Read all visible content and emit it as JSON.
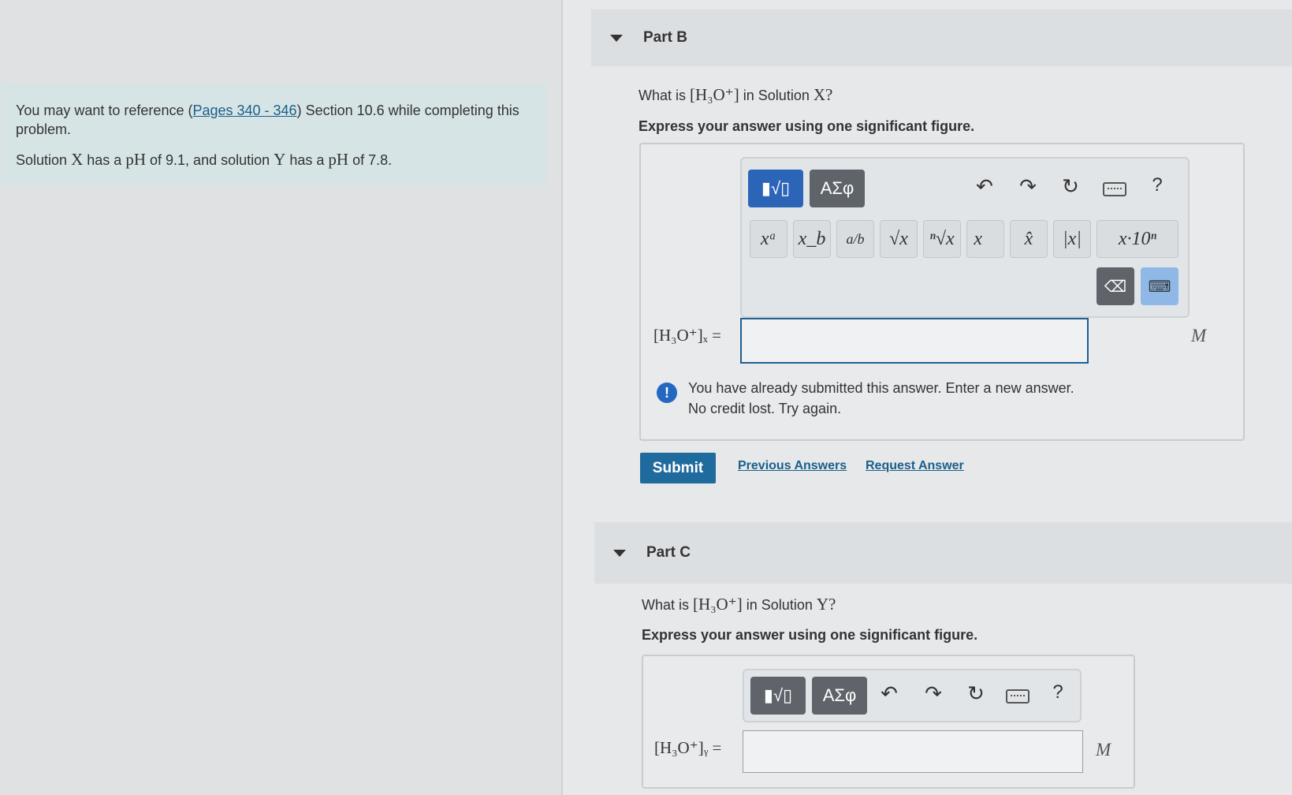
{
  "reference": {
    "prefix": "You may want to reference (",
    "link": "Pages 340 - 346",
    "suffix": ") Section 10.6 while completing this problem.",
    "problem_a": "Solution",
    "var_x": "X",
    "problem_b": "has a",
    "ph": "pH",
    "problem_c": "of 9.1, and solution",
    "var_y": "Y",
    "problem_d": "of 7.8."
  },
  "part_b": {
    "title": "Part B",
    "question_prefix": "What is",
    "question_species": "[H₃O⁺]",
    "question_mid": "in Solution",
    "question_var": "X?",
    "instruction": "Express your answer using one significant figure.",
    "toolbar": {
      "templates_label": "▮√▯",
      "greek_label": "ΑΣφ",
      "help_label": "?",
      "math_buttons": [
        "xᵃ",
        "x_b",
        "a/b",
        "√x",
        "ⁿ√x",
        "x⃗",
        "x̂",
        "|x|",
        "x·10ⁿ"
      ]
    },
    "lhs": "[H₃O⁺]ₓ =",
    "input_value": "",
    "unit": "M",
    "warning_line1": "You have already submitted this answer. Enter a new answer.",
    "warning_line2": "No credit lost. Try again.",
    "submit_label": "Submit",
    "previous_answers": "Previous Answers",
    "request_answer": "Request Answer"
  },
  "part_c": {
    "title": "Part C",
    "question_prefix": "What is",
    "question_species": "[H₃O⁺]",
    "question_mid": "in Solution",
    "question_var": "Y?",
    "instruction": "Express your answer using one significant figure.",
    "toolbar": {
      "templates_label": "▮√▯",
      "greek_label": "ΑΣφ",
      "help_label": "?"
    },
    "lhs": "[H₃O⁺]ᵧ =",
    "input_value": "",
    "unit": "M"
  },
  "colors": {
    "accent": "#2c64b8",
    "submit": "#1f6b9e",
    "link": "#1a5f8a",
    "reference_bg": "#d6e4e6"
  }
}
